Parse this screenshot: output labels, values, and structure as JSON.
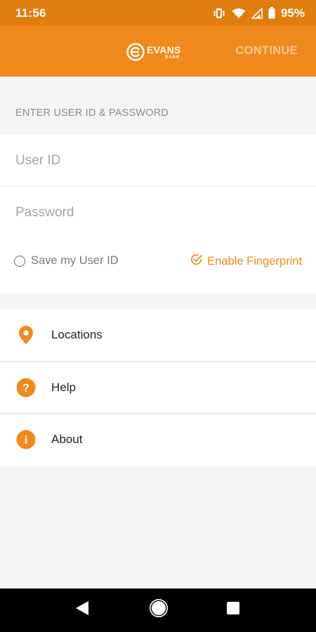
{
  "status_bar": {
    "time": "11:56",
    "battery": "95%",
    "icons": [
      "vibrate-icon",
      "wifi-icon",
      "signal-icon",
      "battery-icon"
    ]
  },
  "app_bar": {
    "logo": "EVANS",
    "logo_sub": "BANK",
    "continue_label": "CONTINUE",
    "color": "#f08a1c"
  },
  "login": {
    "section_title": "ENTER USER ID & PASSWORD",
    "user_id_placeholder": "User ID",
    "user_id_value": "",
    "password_placeholder": "Password",
    "password_value": "",
    "save_user_id_label": "Save my User ID",
    "save_user_id_checked": false,
    "enable_fingerprint_label": "Enable Fingerprint"
  },
  "menu": {
    "items": [
      {
        "label": "Locations",
        "icon": "location-pin-icon"
      },
      {
        "label": "Help",
        "icon": "help-icon"
      },
      {
        "label": "About",
        "icon": "info-icon"
      }
    ]
  },
  "nav_bar": {
    "buttons": [
      "back-icon",
      "home-icon",
      "recents-icon"
    ]
  },
  "colors": {
    "accent": "#ef8a1d",
    "status_bar": "#e07d0f"
  }
}
